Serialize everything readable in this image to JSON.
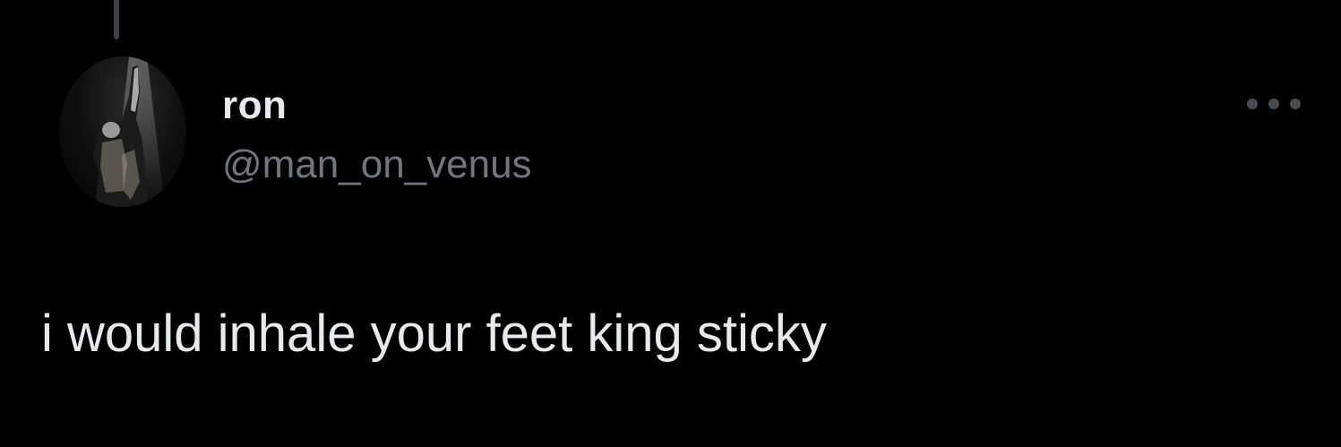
{
  "tweet": {
    "author": {
      "display_name": "ron",
      "handle": "@man_on_venus"
    },
    "text": "i would inhale your feet king sticky",
    "icons": {
      "more": "more-horizontal-icon"
    }
  },
  "colors": {
    "background": "#000000",
    "primary_text": "#e7e9ea",
    "secondary_text": "#71767b",
    "thread_line": "#3e4144"
  }
}
